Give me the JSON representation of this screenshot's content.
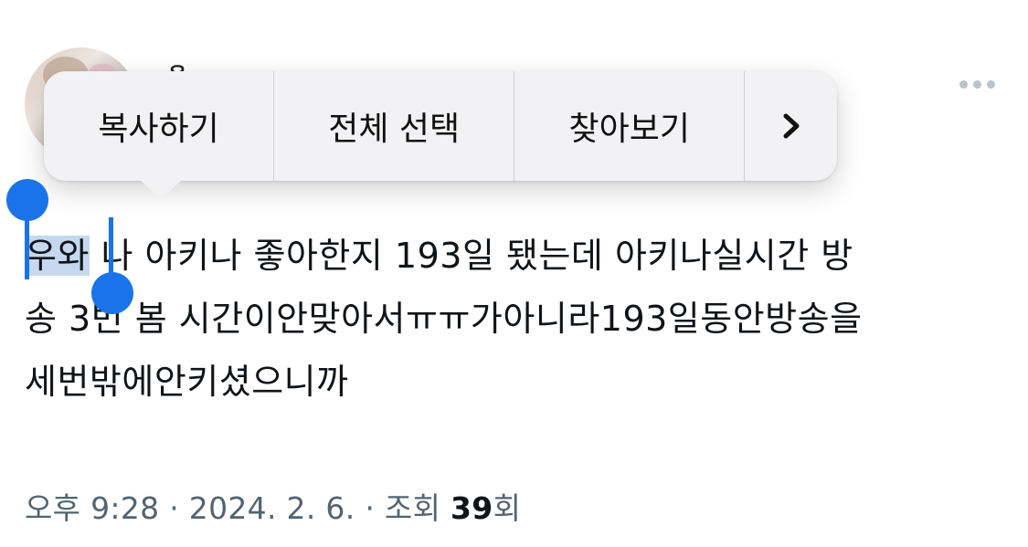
{
  "tweet": {
    "text_selected": "우와",
    "text_line1_rest": " 나 아키나 좋아한지 193일 됐는데 아키나실시간 방",
    "text_line2": "송 3번 봄 시간이안맞아서ㅠㅠ가아니라193일동안방송을",
    "text_line3": "세번밖에안키셨으니까"
  },
  "context_menu": {
    "items": [
      "복사하기",
      "전체 선택",
      "찾아보기"
    ],
    "more_icon": "chevron-right-icon"
  },
  "meta": {
    "time": "오후 9:28",
    "sep1": " · ",
    "date": "2024. 2. 6.",
    "sep2": " · ",
    "views_label": "조회 ",
    "views_count": "39",
    "views_suffix": "회"
  },
  "icons": {
    "more": "more-horizontal-icon",
    "avatar": "avatar"
  },
  "colors": {
    "selection_handle": "#1a73e8",
    "selection_highlight": "#c5d8f0",
    "meta_text": "#536471",
    "more_icon": "#b9c3cd"
  }
}
